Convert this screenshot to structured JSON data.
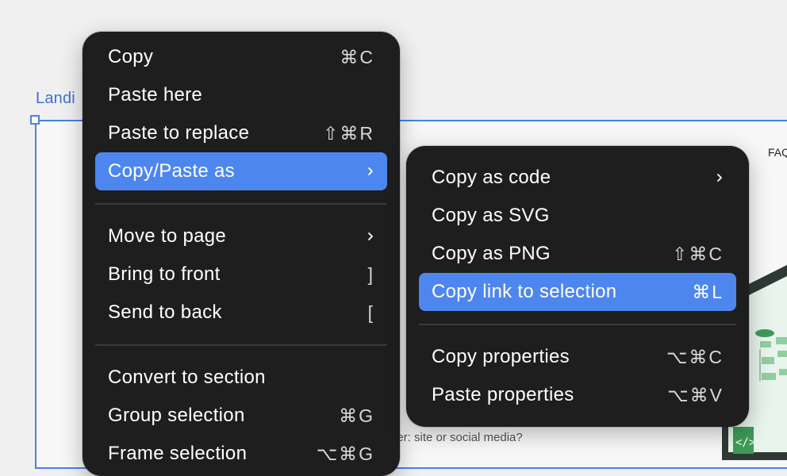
{
  "background": {
    "frame_label": "Landi",
    "faq_text": "FAQ",
    "question_text": "her: site or social media?"
  },
  "main_menu": {
    "items": [
      {
        "label": "Copy",
        "shortcut": "⌘C"
      },
      {
        "label": "Paste here",
        "shortcut": ""
      },
      {
        "label": "Paste to replace",
        "shortcut": "⇧⌘R"
      },
      {
        "label": "Copy/Paste as",
        "submenu": true,
        "highlighted": true
      },
      {
        "label": "Move to page",
        "submenu": true
      },
      {
        "label": "Bring to front",
        "shortcut": "]"
      },
      {
        "label": "Send to back",
        "shortcut": "["
      },
      {
        "label": "Convert to section",
        "shortcut": ""
      },
      {
        "label": "Group selection",
        "shortcut": "⌘G"
      },
      {
        "label": "Frame selection",
        "shortcut": "⌥⌘G"
      }
    ]
  },
  "sub_menu": {
    "items": [
      {
        "label": "Copy as code",
        "submenu": true
      },
      {
        "label": "Copy as SVG",
        "shortcut": ""
      },
      {
        "label": "Copy as PNG",
        "shortcut": "⇧⌘C"
      },
      {
        "label": "Copy link to selection",
        "shortcut": "⌘L",
        "highlighted": true
      },
      {
        "label": "Copy properties",
        "shortcut": "⌥⌘C"
      },
      {
        "label": "Paste properties",
        "shortcut": "⌥⌘V"
      }
    ]
  },
  "colors": {
    "menu_background": "#1e1e1e",
    "highlight": "#4d86ee",
    "selection_blue": "#4a80e8",
    "canvas": "#f0f0f0"
  },
  "icons": [
    "chevron-right-icon",
    "frame-resize-handle"
  ]
}
